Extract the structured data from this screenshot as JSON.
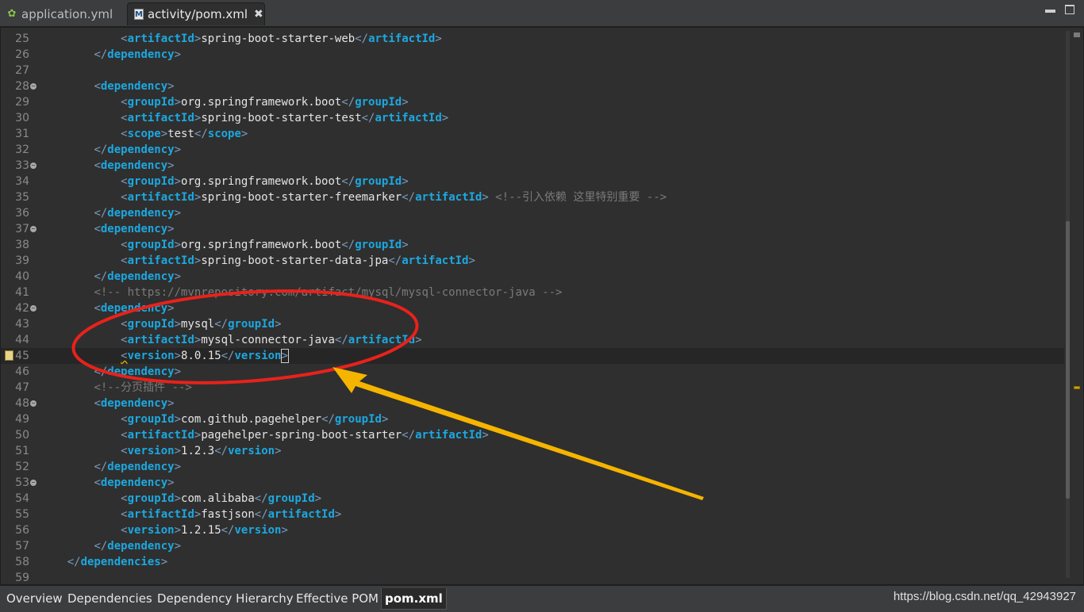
{
  "tabs": [
    {
      "label": "application.yml",
      "icon": "spring-leaf-icon",
      "active": false
    },
    {
      "label": "activity/pom.xml",
      "icon": "maven-xml-icon",
      "active": true
    }
  ],
  "window_controls": {
    "minimize": "▬",
    "close": "▬"
  },
  "code_lines": [
    {
      "n": "25",
      "fold": false,
      "parts": [
        [
          "i",
          "            "
        ],
        [
          "b",
          "<"
        ],
        [
          "tg",
          "artifactId"
        ],
        [
          "b",
          ">"
        ],
        [
          "tx",
          "spring-boot-starter-web"
        ],
        [
          "b",
          "</"
        ],
        [
          "tg",
          "artifactId"
        ],
        [
          "b",
          ">"
        ]
      ]
    },
    {
      "n": "26",
      "fold": false,
      "parts": [
        [
          "i",
          "        "
        ],
        [
          "b",
          "</"
        ],
        [
          "tg",
          "dependency"
        ],
        [
          "b",
          ">"
        ]
      ]
    },
    {
      "n": "27",
      "fold": false,
      "parts": []
    },
    {
      "n": "28",
      "fold": true,
      "parts": [
        [
          "i",
          "        "
        ],
        [
          "b",
          "<"
        ],
        [
          "tg",
          "dependency"
        ],
        [
          "b",
          ">"
        ]
      ]
    },
    {
      "n": "29",
      "fold": false,
      "parts": [
        [
          "i",
          "            "
        ],
        [
          "b",
          "<"
        ],
        [
          "tg",
          "groupId"
        ],
        [
          "b",
          ">"
        ],
        [
          "tx",
          "org.springframework.boot"
        ],
        [
          "b",
          "</"
        ],
        [
          "tg",
          "groupId"
        ],
        [
          "b",
          ">"
        ]
      ]
    },
    {
      "n": "30",
      "fold": false,
      "parts": [
        [
          "i",
          "            "
        ],
        [
          "b",
          "<"
        ],
        [
          "tg",
          "artifactId"
        ],
        [
          "b",
          ">"
        ],
        [
          "tx",
          "spring-boot-starter-test"
        ],
        [
          "b",
          "</"
        ],
        [
          "tg",
          "artifactId"
        ],
        [
          "b",
          ">"
        ]
      ]
    },
    {
      "n": "31",
      "fold": false,
      "parts": [
        [
          "i",
          "            "
        ],
        [
          "b",
          "<"
        ],
        [
          "tg",
          "scope"
        ],
        [
          "b",
          ">"
        ],
        [
          "tx",
          "test"
        ],
        [
          "b",
          "</"
        ],
        [
          "tg",
          "scope"
        ],
        [
          "b",
          ">"
        ]
      ]
    },
    {
      "n": "32",
      "fold": false,
      "parts": [
        [
          "i",
          "        "
        ],
        [
          "b",
          "</"
        ],
        [
          "tg",
          "dependency"
        ],
        [
          "b",
          ">"
        ]
      ]
    },
    {
      "n": "33",
      "fold": true,
      "parts": [
        [
          "i",
          "        "
        ],
        [
          "b",
          "<"
        ],
        [
          "tg",
          "dependency"
        ],
        [
          "b",
          ">"
        ]
      ]
    },
    {
      "n": "34",
      "fold": false,
      "parts": [
        [
          "i",
          "            "
        ],
        [
          "b",
          "<"
        ],
        [
          "tg",
          "groupId"
        ],
        [
          "b",
          ">"
        ],
        [
          "tx",
          "org.springframework.boot"
        ],
        [
          "b",
          "</"
        ],
        [
          "tg",
          "groupId"
        ],
        [
          "b",
          ">"
        ]
      ]
    },
    {
      "n": "35",
      "fold": false,
      "parts": [
        [
          "i",
          "            "
        ],
        [
          "b",
          "<"
        ],
        [
          "tg",
          "artifactId"
        ],
        [
          "b",
          ">"
        ],
        [
          "tx",
          "spring-boot-starter-freemarker"
        ],
        [
          "b",
          "</"
        ],
        [
          "tg",
          "artifactId"
        ],
        [
          "b",
          ">"
        ],
        [
          "i",
          " "
        ],
        [
          "cm",
          "<!--引入依赖 这里特别重要 -->"
        ]
      ]
    },
    {
      "n": "36",
      "fold": false,
      "parts": [
        [
          "i",
          "        "
        ],
        [
          "b",
          "</"
        ],
        [
          "tg",
          "dependency"
        ],
        [
          "b",
          ">"
        ]
      ]
    },
    {
      "n": "37",
      "fold": true,
      "parts": [
        [
          "i",
          "        "
        ],
        [
          "b",
          "<"
        ],
        [
          "tg",
          "dependency"
        ],
        [
          "b",
          ">"
        ]
      ]
    },
    {
      "n": "38",
      "fold": false,
      "parts": [
        [
          "i",
          "            "
        ],
        [
          "b",
          "<"
        ],
        [
          "tg",
          "groupId"
        ],
        [
          "b",
          ">"
        ],
        [
          "tx",
          "org.springframework.boot"
        ],
        [
          "b",
          "</"
        ],
        [
          "tg",
          "groupId"
        ],
        [
          "b",
          ">"
        ]
      ]
    },
    {
      "n": "39",
      "fold": false,
      "parts": [
        [
          "i",
          "            "
        ],
        [
          "b",
          "<"
        ],
        [
          "tg",
          "artifactId"
        ],
        [
          "b",
          ">"
        ],
        [
          "tx",
          "spring-boot-starter-data-jpa"
        ],
        [
          "b",
          "</"
        ],
        [
          "tg",
          "artifactId"
        ],
        [
          "b",
          ">"
        ]
      ]
    },
    {
      "n": "40",
      "fold": false,
      "parts": [
        [
          "i",
          "        "
        ],
        [
          "b",
          "</"
        ],
        [
          "tg",
          "dependency"
        ],
        [
          "b",
          ">"
        ]
      ]
    },
    {
      "n": "41",
      "fold": false,
      "parts": [
        [
          "i",
          "        "
        ],
        [
          "cm",
          "<!-- https://mvnrepository.com/artifact/mysql/mysql-connector-java -->"
        ]
      ]
    },
    {
      "n": "42",
      "fold": true,
      "parts": [
        [
          "i",
          "        "
        ],
        [
          "b",
          "<"
        ],
        [
          "tg",
          "dependency"
        ],
        [
          "b",
          ">"
        ]
      ]
    },
    {
      "n": "43",
      "fold": false,
      "parts": [
        [
          "i",
          "            "
        ],
        [
          "b",
          "<"
        ],
        [
          "tg",
          "groupId"
        ],
        [
          "b",
          ">"
        ],
        [
          "tx",
          "mysql"
        ],
        [
          "b",
          "</"
        ],
        [
          "tg",
          "groupId"
        ],
        [
          "b",
          ">"
        ]
      ]
    },
    {
      "n": "44",
      "fold": false,
      "parts": [
        [
          "i",
          "            "
        ],
        [
          "b",
          "<"
        ],
        [
          "tg",
          "artifactId"
        ],
        [
          "b",
          ">"
        ],
        [
          "tx",
          "mysql-connector-java"
        ],
        [
          "b",
          "</"
        ],
        [
          "tg",
          "artifactId"
        ],
        [
          "b",
          ">"
        ]
      ]
    },
    {
      "n": "45",
      "fold": false,
      "current": true,
      "bookmark": true,
      "parts": [
        [
          "i",
          "            "
        ],
        [
          "sq",
          "<"
        ],
        [
          "tg",
          "version"
        ],
        [
          "b",
          ">"
        ],
        [
          "tx",
          "8.0.15"
        ],
        [
          "b",
          "</"
        ],
        [
          "tg",
          "version"
        ],
        [
          "cb",
          ">"
        ]
      ]
    },
    {
      "n": "46",
      "fold": false,
      "parts": [
        [
          "i",
          "        "
        ],
        [
          "b",
          "</"
        ],
        [
          "tg",
          "dependency"
        ],
        [
          "b",
          ">"
        ]
      ]
    },
    {
      "n": "47",
      "fold": false,
      "parts": [
        [
          "i",
          "        "
        ],
        [
          "cm",
          "<!--分页插件 -->"
        ]
      ]
    },
    {
      "n": "48",
      "fold": true,
      "parts": [
        [
          "i",
          "        "
        ],
        [
          "b",
          "<"
        ],
        [
          "tg",
          "dependency"
        ],
        [
          "b",
          ">"
        ]
      ]
    },
    {
      "n": "49",
      "fold": false,
      "parts": [
        [
          "i",
          "            "
        ],
        [
          "b",
          "<"
        ],
        [
          "tg",
          "groupId"
        ],
        [
          "b",
          ">"
        ],
        [
          "tx",
          "com.github.pagehelper"
        ],
        [
          "b",
          "</"
        ],
        [
          "tg",
          "groupId"
        ],
        [
          "b",
          ">"
        ]
      ]
    },
    {
      "n": "50",
      "fold": false,
      "parts": [
        [
          "i",
          "            "
        ],
        [
          "b",
          "<"
        ],
        [
          "tg",
          "artifactId"
        ],
        [
          "b",
          ">"
        ],
        [
          "tx",
          "pagehelper-spring-boot-starter"
        ],
        [
          "b",
          "</"
        ],
        [
          "tg",
          "artifactId"
        ],
        [
          "b",
          ">"
        ]
      ]
    },
    {
      "n": "51",
      "fold": false,
      "parts": [
        [
          "i",
          "            "
        ],
        [
          "b",
          "<"
        ],
        [
          "tg",
          "version"
        ],
        [
          "b",
          ">"
        ],
        [
          "tx",
          "1.2.3"
        ],
        [
          "b",
          "</"
        ],
        [
          "tg",
          "version"
        ],
        [
          "b",
          ">"
        ]
      ]
    },
    {
      "n": "52",
      "fold": false,
      "parts": [
        [
          "i",
          "        "
        ],
        [
          "b",
          "</"
        ],
        [
          "tg",
          "dependency"
        ],
        [
          "b",
          ">"
        ]
      ]
    },
    {
      "n": "53",
      "fold": true,
      "parts": [
        [
          "i",
          "        "
        ],
        [
          "b",
          "<"
        ],
        [
          "tg",
          "dependency"
        ],
        [
          "b",
          ">"
        ]
      ]
    },
    {
      "n": "54",
      "fold": false,
      "parts": [
        [
          "i",
          "            "
        ],
        [
          "b",
          "<"
        ],
        [
          "tg",
          "groupId"
        ],
        [
          "b",
          ">"
        ],
        [
          "tx",
          "com.alibaba"
        ],
        [
          "b",
          "</"
        ],
        [
          "tg",
          "groupId"
        ],
        [
          "b",
          ">"
        ]
      ]
    },
    {
      "n": "55",
      "fold": false,
      "parts": [
        [
          "i",
          "            "
        ],
        [
          "b",
          "<"
        ],
        [
          "tg",
          "artifactId"
        ],
        [
          "b",
          ">"
        ],
        [
          "tx",
          "fastjson"
        ],
        [
          "b",
          "</"
        ],
        [
          "tg",
          "artifactId"
        ],
        [
          "b",
          ">"
        ]
      ]
    },
    {
      "n": "56",
      "fold": false,
      "parts": [
        [
          "i",
          "            "
        ],
        [
          "b",
          "<"
        ],
        [
          "tg",
          "version"
        ],
        [
          "b",
          ">"
        ],
        [
          "tx",
          "1.2.15"
        ],
        [
          "b",
          "</"
        ],
        [
          "tg",
          "version"
        ],
        [
          "b",
          ">"
        ]
      ]
    },
    {
      "n": "57",
      "fold": false,
      "parts": [
        [
          "i",
          "        "
        ],
        [
          "b",
          "</"
        ],
        [
          "tg",
          "dependency"
        ],
        [
          "b",
          ">"
        ]
      ]
    },
    {
      "n": "58",
      "fold": false,
      "parts": [
        [
          "i",
          "    "
        ],
        [
          "b",
          "</"
        ],
        [
          "tg",
          "dependencies"
        ],
        [
          "b",
          ">"
        ]
      ]
    },
    {
      "n": "59",
      "fold": false,
      "parts": []
    }
  ],
  "bottom_tabs": [
    {
      "label": "Overview",
      "active": false
    },
    {
      "label": "Dependencies",
      "active": false
    },
    {
      "label": "Dependency Hierarchy",
      "active": false
    },
    {
      "label": "Effective POM",
      "active": false
    },
    {
      "label": "pom.xml",
      "active": true
    }
  ],
  "watermark": "https://blog.csdn.net/qq_42943927",
  "colors": {
    "tag": "#1ca8e0",
    "bracket": "#7a9bbd",
    "text": "#e4e4e4",
    "comment": "#7a7a7a",
    "annotation_ellipse": "#e8221b",
    "annotation_arrow": "#f5b400"
  }
}
